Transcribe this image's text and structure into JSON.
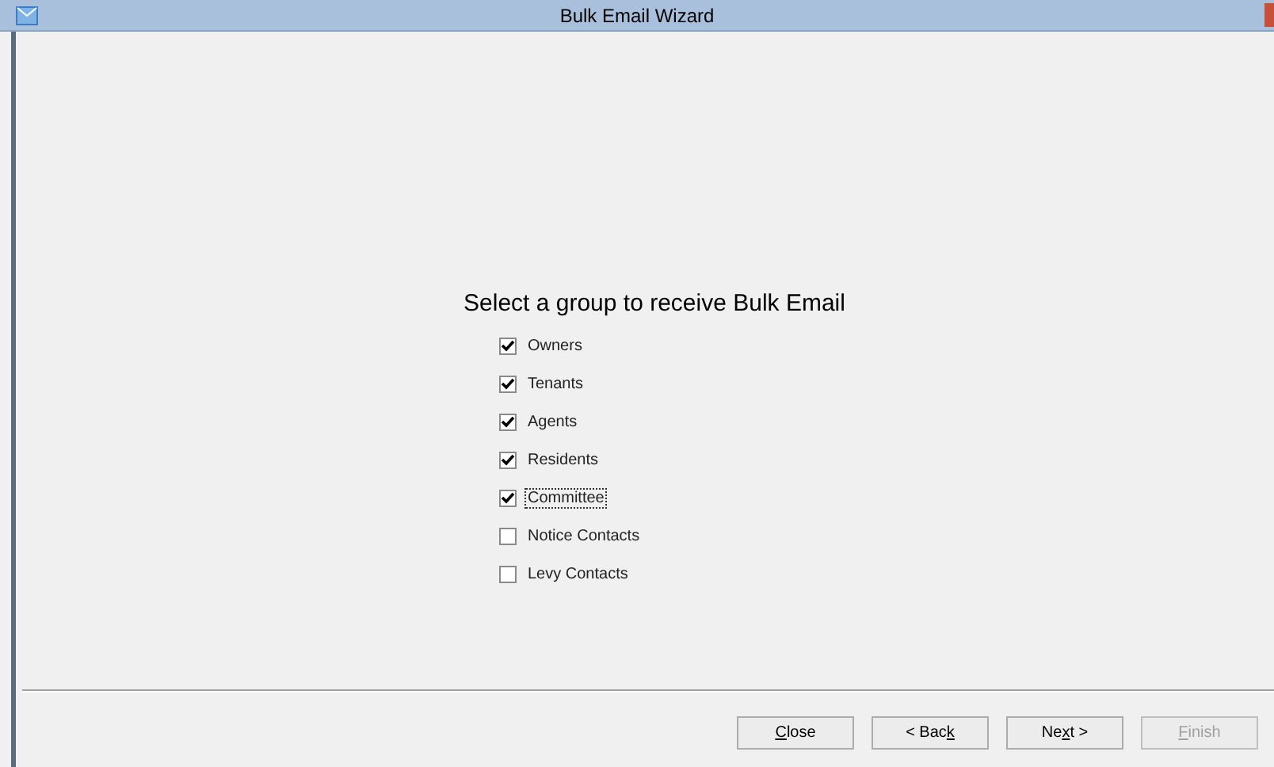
{
  "window": {
    "title": "Bulk Email Wizard"
  },
  "heading": "Select a group to receive Bulk Email",
  "groups": [
    {
      "label": "Owners",
      "checked": true,
      "focused": false
    },
    {
      "label": "Tenants",
      "checked": true,
      "focused": false
    },
    {
      "label": "Agents",
      "checked": true,
      "focused": false
    },
    {
      "label": "Residents",
      "checked": true,
      "focused": false
    },
    {
      "label": "Committee",
      "checked": true,
      "focused": true
    },
    {
      "label": "Notice Contacts",
      "checked": false,
      "focused": false
    },
    {
      "label": "Levy Contacts",
      "checked": false,
      "focused": false
    }
  ],
  "buttons": [
    {
      "mnemonic": "C",
      "after": "lose",
      "disabled": false
    },
    {
      "before": "< Bac",
      "mnemonic": "k",
      "disabled": false
    },
    {
      "before": "Ne",
      "mnemonic": "x",
      "after": "t >",
      "disabled": false
    },
    {
      "mnemonic": "F",
      "after": "inish",
      "disabled": true
    }
  ]
}
